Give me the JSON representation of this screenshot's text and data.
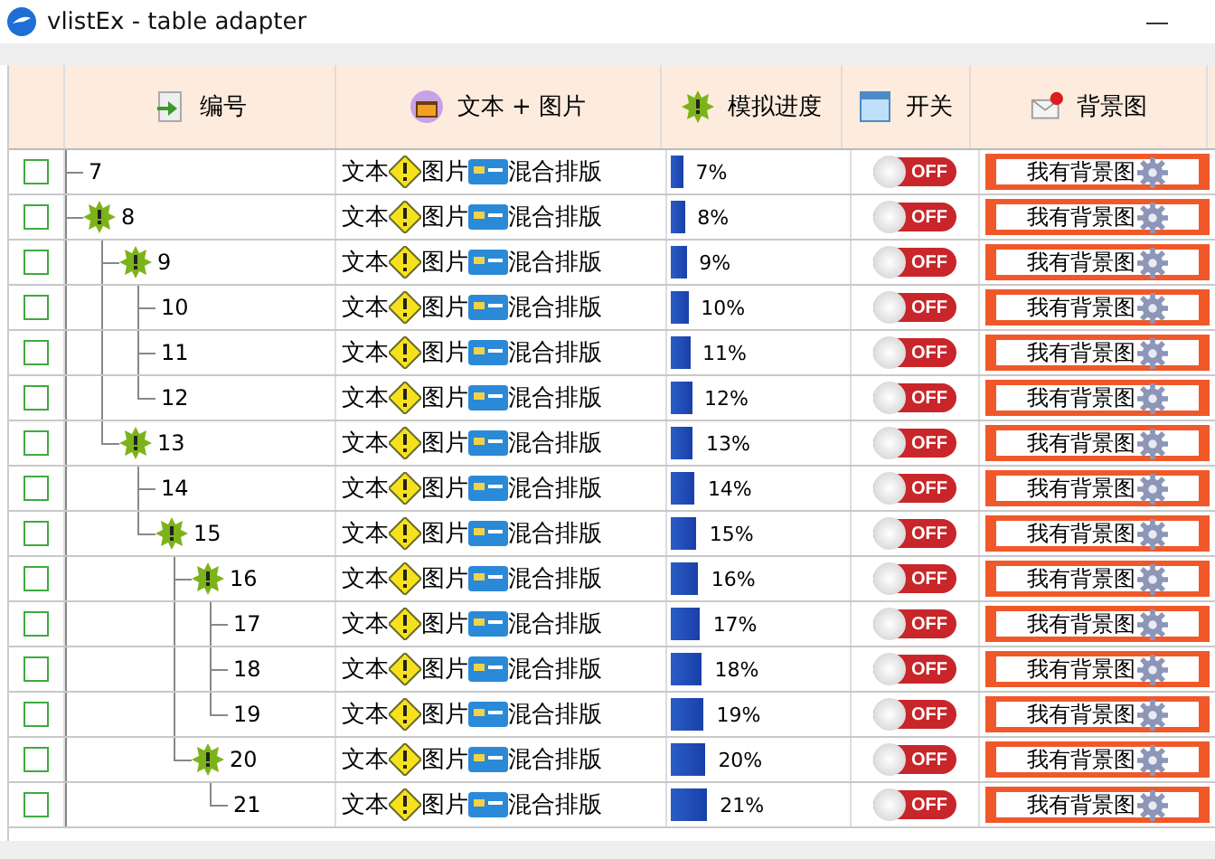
{
  "window": {
    "title": "vlistEx - table adapter",
    "minimize": "—"
  },
  "columns": [
    {
      "label": "编号",
      "kind": "id"
    },
    {
      "label": "文本 + 图片",
      "kind": "text"
    },
    {
      "label": "模拟进度",
      "kind": "progress"
    },
    {
      "label": "开关",
      "kind": "switch"
    },
    {
      "label": "背景图",
      "kind": "background"
    }
  ],
  "rows": [
    {
      "id": "7",
      "checked": false,
      "text": [
        "文本",
        "图片",
        "混合排版"
      ],
      "progress": {
        "level": 0.07,
        "reading": "7%"
      },
      "switch": {
        "on": false,
        "label": "OFF"
      },
      "button": "我有背景图"
    },
    {
      "id": "8",
      "checked": false,
      "text": [
        "文本",
        "图片",
        "混合排版"
      ],
      "progress": {
        "level": 0.08,
        "reading": "8%"
      },
      "switch": {
        "on": false,
        "label": "OFF"
      },
      "button": "我有背景图",
      "children": [
        {
          "id": "9",
          "checked": false,
          "text": [
            "文本",
            "图片",
            "混合排版"
          ],
          "progress": {
            "level": 0.09,
            "reading": "9%"
          },
          "switch": {
            "on": false,
            "label": "OFF"
          },
          "button": "我有背景图",
          "children": [
            {
              "id": "10",
              "checked": false,
              "text": [
                "文本",
                "图片",
                "混合排版"
              ],
              "progress": {
                "level": 0.1,
                "reading": "10%"
              },
              "switch": {
                "on": false,
                "label": "OFF"
              },
              "button": "我有背景图"
            },
            {
              "id": "11",
              "checked": false,
              "text": [
                "文本",
                "图片",
                "混合排版"
              ],
              "progress": {
                "level": 0.11,
                "reading": "11%"
              },
              "switch": {
                "on": false,
                "label": "OFF"
              },
              "button": "我有背景图"
            },
            {
              "id": "12",
              "checked": false,
              "text": [
                "文本",
                "图片",
                "混合排版"
              ],
              "progress": {
                "level": 0.12,
                "reading": "12%"
              },
              "switch": {
                "on": false,
                "label": "OFF"
              },
              "button": "我有背景图"
            }
          ]
        },
        {
          "id": "13",
          "checked": false,
          "text": [
            "文本",
            "图片",
            "混合排版"
          ],
          "progress": {
            "level": 0.13,
            "reading": "13%"
          },
          "switch": {
            "on": false,
            "label": "OFF"
          },
          "button": "我有背景图",
          "children": [
            {
              "id": "14",
              "checked": false,
              "text": [
                "文本",
                "图片",
                "混合排版"
              ],
              "progress": {
                "level": 0.14,
                "reading": "14%"
              },
              "switch": {
                "on": false,
                "label": "OFF"
              },
              "button": "我有背景图"
            },
            {
              "id": "15",
              "checked": false,
              "text": [
                "文本",
                "图片",
                "混合排版"
              ],
              "progress": {
                "level": 0.15,
                "reading": "15%"
              },
              "switch": {
                "on": false,
                "label": "OFF"
              },
              "button": "我有背景图",
              "children": [
                {
                  "id": "16",
                  "checked": false,
                  "text": [
                    "文本",
                    "图片",
                    "混合排版"
                  ],
                  "progress": {
                    "level": 0.16,
                    "reading": "16%"
                  },
                  "switch": {
                    "on": false,
                    "label": "OFF"
                  },
                  "button": "我有背景图",
                  "children": [
                    {
                      "id": "17",
                      "checked": false,
                      "text": [
                        "文本",
                        "图片",
                        "混合排版"
                      ],
                      "progress": {
                        "level": 0.17,
                        "reading": "17%"
                      },
                      "switch": {
                        "on": false,
                        "label": "OFF"
                      },
                      "button": "我有背景图"
                    },
                    {
                      "id": "18",
                      "checked": false,
                      "text": [
                        "文本",
                        "图片",
                        "混合排版"
                      ],
                      "progress": {
                        "level": 0.18,
                        "reading": "18%"
                      },
                      "switch": {
                        "on": false,
                        "label": "OFF"
                      },
                      "button": "我有背景图"
                    },
                    {
                      "id": "19",
                      "checked": false,
                      "text": [
                        "文本",
                        "图片",
                        "混合排版"
                      ],
                      "progress": {
                        "level": 0.19,
                        "reading": "19%"
                      },
                      "switch": {
                        "on": false,
                        "label": "OFF"
                      },
                      "button": "我有背景图"
                    }
                  ]
                },
                {
                  "id": "20",
                  "checked": false,
                  "text": [
                    "文本",
                    "图片",
                    "混合排版"
                  ],
                  "progress": {
                    "level": 0.2,
                    "reading": "20%"
                  },
                  "switch": {
                    "on": false,
                    "label": "OFF"
                  },
                  "button": "我有背景图",
                  "children": [
                    {
                      "id": "21",
                      "checked": false,
                      "text": [
                        "文本",
                        "图片",
                        "混合排版"
                      ],
                      "progress": {
                        "level": 0.21,
                        "reading": "21%"
                      },
                      "switch": {
                        "on": false,
                        "label": "OFF"
                      },
                      "button": "我有背景图"
                    }
                  ]
                }
              ]
            }
          ]
        }
      ]
    }
  ]
}
